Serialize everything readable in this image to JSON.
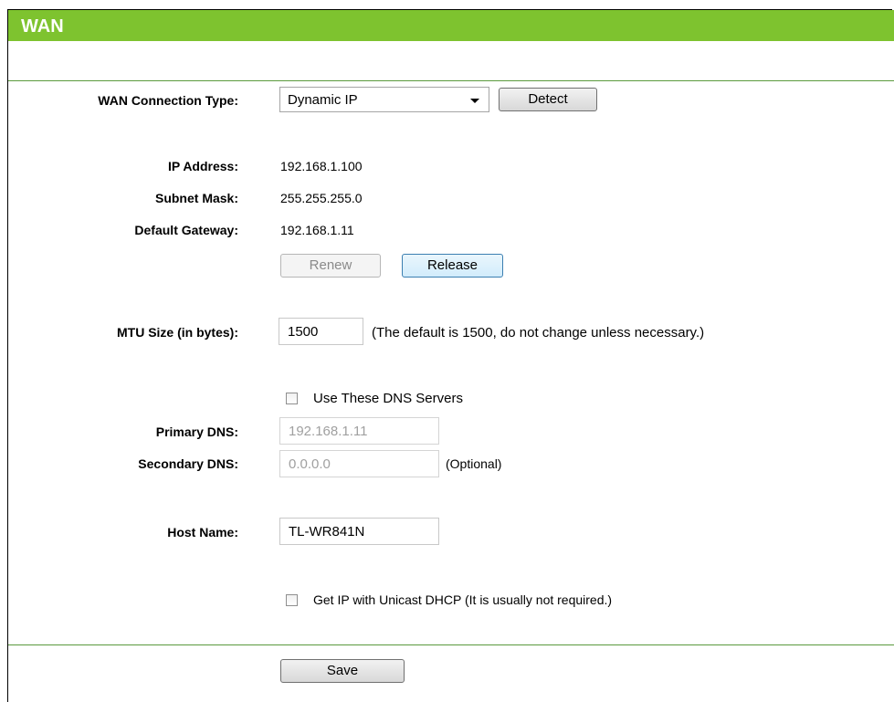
{
  "header": {
    "title": "WAN"
  },
  "connection": {
    "label": "WAN Connection Type:",
    "selected": "Dynamic IP",
    "detect_label": "Detect"
  },
  "status": {
    "ip_label": "IP Address:",
    "ip_value": "192.168.1.100",
    "mask_label": "Subnet Mask:",
    "mask_value": "255.255.255.0",
    "gateway_label": "Default Gateway:",
    "gateway_value": "192.168.1.11",
    "renew_label": "Renew",
    "release_label": "Release"
  },
  "mtu": {
    "label": "MTU Size (in bytes):",
    "value": "1500",
    "hint": "(The default is 1500, do not change unless necessary.)"
  },
  "dns": {
    "checkbox_label": "Use These DNS Servers",
    "checked": false,
    "primary_label": "Primary DNS:",
    "primary_value": "192.168.1.11",
    "secondary_label": "Secondary DNS:",
    "secondary_value": "0.0.0.0",
    "optional_label": "(Optional)"
  },
  "host": {
    "label": "Host Name:",
    "value": "TL-WR841N"
  },
  "unicast": {
    "checkbox_label": "Get IP with Unicast DHCP (It is usually not required.)",
    "checked": false
  },
  "footer": {
    "save_label": "Save"
  },
  "colors": {
    "title_bar": "#7ec32f",
    "divider": "#5a9a3e"
  }
}
